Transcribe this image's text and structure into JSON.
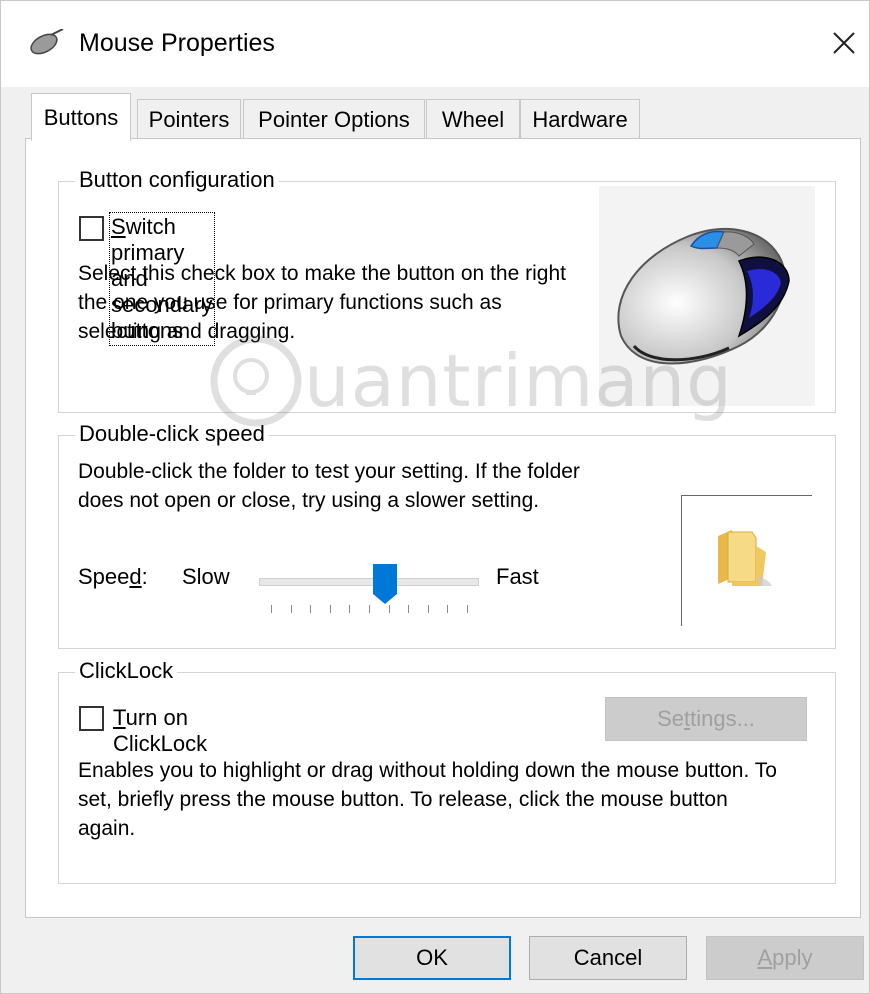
{
  "window": {
    "title": "Mouse Properties",
    "close_icon": "close-icon",
    "app_icon": "mouse-icon"
  },
  "tabs": [
    {
      "label": "Buttons",
      "active": true
    },
    {
      "label": "Pointers",
      "active": false
    },
    {
      "label": "Pointer Options",
      "active": false
    },
    {
      "label": "Wheel",
      "active": false
    },
    {
      "label": "Hardware",
      "active": false
    }
  ],
  "button_config": {
    "group_label": "Button configuration",
    "switch_checkbox": {
      "label_underlined": "S",
      "label_rest": "witch primary and secondary buttons",
      "checked": false
    },
    "description": "Select this check box to make the button on the right the one you use for primary functions such as selecting and dragging.",
    "image": "mouse-illustration"
  },
  "double_click": {
    "group_label": "Double-click speed",
    "description": "Double-click the folder to test your setting. If the folder does not open or close, try using a slower setting.",
    "speed_label_pre": "Spee",
    "speed_label_underlined": "d",
    "speed_label_post": ":",
    "slow_label": "Slow",
    "fast_label": "Fast",
    "slider_value": 0.58,
    "slider_ticks": 11,
    "test_icon": "folder-icon"
  },
  "clicklock": {
    "group_label": "ClickLock",
    "checkbox": {
      "label_underlined": "T",
      "label_rest": "urn on ClickLock",
      "checked": false
    },
    "settings_button": {
      "label_pre": "Se",
      "label_underlined": "t",
      "label_post": "tings...",
      "enabled": false
    },
    "description": "Enables you to highlight or drag without holding down the mouse button. To set, briefly press the mouse button. To release, click the mouse button again."
  },
  "footer": {
    "ok_label": "OK",
    "cancel_label": "Cancel",
    "apply_underlined": "A",
    "apply_rest": "pply",
    "apply_enabled": false
  },
  "watermark": {
    "text": "uantrimang"
  },
  "colors": {
    "accent": "#0078d7",
    "panel_bg": "#ffffff",
    "dialog_bg": "#f0f0f0"
  }
}
